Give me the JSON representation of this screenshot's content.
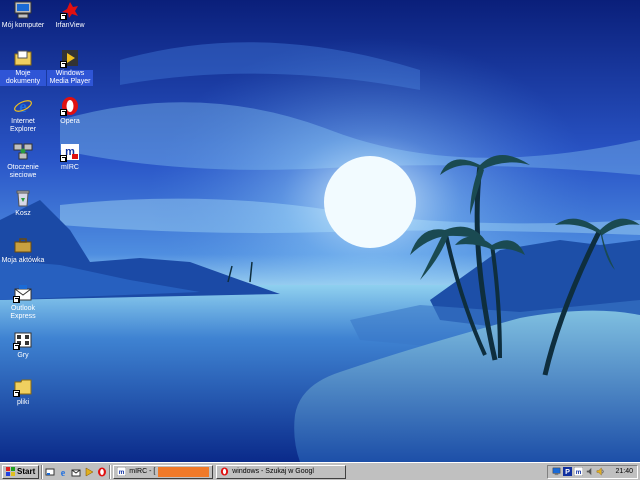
{
  "desktop": {
    "icons": [
      {
        "label": "Mój komputer",
        "icon": "my-computer-icon"
      },
      {
        "label": "IrfanView",
        "icon": "irfanview-icon"
      },
      {
        "label": "Moje dokumenty",
        "icon": "my-documents-icon"
      },
      {
        "label": "Windows Media Player",
        "icon": "media-player-icon"
      },
      {
        "label": "Internet Explorer",
        "icon": "internet-explorer-icon"
      },
      {
        "label": "Opera",
        "icon": "opera-icon"
      },
      {
        "label": "Otoczenie sieciowe",
        "icon": "network-icon"
      },
      {
        "label": "mIRC",
        "icon": "mirc-icon"
      },
      {
        "label": "Kosz",
        "icon": "recycle-bin-icon"
      },
      {
        "label": "Moja aktówka",
        "icon": "briefcase-icon"
      },
      {
        "label": "Outlook Express",
        "icon": "outlook-express-icon"
      },
      {
        "label": "Gry",
        "icon": "games-icon"
      },
      {
        "label": "pliki",
        "icon": "folder-icon"
      }
    ]
  },
  "taskbar": {
    "start_label": "Start",
    "quick_launch": [
      "show-desktop-icon",
      "internet-explorer-icon",
      "outlook-icon",
      "media-player-icon",
      "opera-icon"
    ],
    "tasks": [
      {
        "label": "mIRC - [",
        "icon": "mirc-icon",
        "flashing": true
      },
      {
        "label": "windows - Szukaj w Googl",
        "icon": "opera-icon",
        "flashing": false
      }
    ],
    "tray_icons": [
      "network-tray-icon",
      "p-tray-icon",
      "mirc-tray-icon",
      "volume-icon",
      "speaker-icon"
    ],
    "clock": "21:40"
  },
  "colors": {
    "selection": "#2f55d6",
    "taskbar": "#c0c0c0",
    "task_flash": "#f07a2a"
  }
}
